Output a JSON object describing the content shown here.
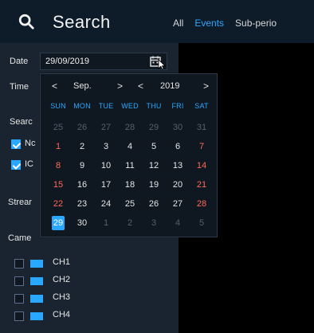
{
  "header": {
    "title": "Search",
    "tabs": [
      {
        "label": "All",
        "active": false
      },
      {
        "label": "Events",
        "active": true
      },
      {
        "label": "Sub-perio",
        "active": false
      }
    ]
  },
  "sidebar": {
    "date_label": "Date",
    "date_value": "29/09/2019",
    "time_label": "Time",
    "search_label": "Searc",
    "search_options": [
      {
        "label": "Nc",
        "checked": true
      },
      {
        "label": "IC",
        "checked": true
      }
    ],
    "stream_label": "Strear",
    "camera_label": "Came",
    "channels": [
      {
        "label": "CH1",
        "checked": false
      },
      {
        "label": "CH2",
        "checked": false
      },
      {
        "label": "CH3",
        "checked": false
      },
      {
        "label": "CH4",
        "checked": false
      }
    ]
  },
  "calendar": {
    "month": "Sep.",
    "year": "2019",
    "prev_symbol": "<",
    "next_symbol": ">",
    "weekdays": [
      "SUN",
      "MON",
      "TUE",
      "WED",
      "THU",
      "FRI",
      "SAT"
    ],
    "days": [
      {
        "d": "25",
        "other": true
      },
      {
        "d": "26",
        "other": true
      },
      {
        "d": "27",
        "other": true
      },
      {
        "d": "28",
        "other": true
      },
      {
        "d": "29",
        "other": true
      },
      {
        "d": "30",
        "other": true
      },
      {
        "d": "31",
        "other": true
      },
      {
        "d": "1",
        "weekend": true
      },
      {
        "d": "2"
      },
      {
        "d": "3"
      },
      {
        "d": "4"
      },
      {
        "d": "5"
      },
      {
        "d": "6"
      },
      {
        "d": "7",
        "weekend": true
      },
      {
        "d": "8",
        "weekend": true
      },
      {
        "d": "9"
      },
      {
        "d": "10"
      },
      {
        "d": "11"
      },
      {
        "d": "12"
      },
      {
        "d": "13"
      },
      {
        "d": "14",
        "weekend": true
      },
      {
        "d": "15",
        "weekend": true
      },
      {
        "d": "16"
      },
      {
        "d": "17"
      },
      {
        "d": "18"
      },
      {
        "d": "19"
      },
      {
        "d": "20"
      },
      {
        "d": "21",
        "weekend": true
      },
      {
        "d": "22",
        "weekend": true
      },
      {
        "d": "23"
      },
      {
        "d": "24"
      },
      {
        "d": "25"
      },
      {
        "d": "26"
      },
      {
        "d": "27"
      },
      {
        "d": "28",
        "weekend": true
      },
      {
        "d": "29",
        "selected": true
      },
      {
        "d": "30"
      },
      {
        "d": "1",
        "other": true
      },
      {
        "d": "2",
        "other": true
      },
      {
        "d": "3",
        "other": true
      },
      {
        "d": "4",
        "other": true
      },
      {
        "d": "5",
        "other": true
      }
    ]
  },
  "colors": {
    "accent": "#2aa8ff",
    "weekend": "#ff6b5a",
    "panel": "#1a2430",
    "header": "#0e1b28"
  },
  "icons": {
    "search": "search-icon",
    "calendar": "calendar-icon",
    "cursor": "mouse-cursor-icon"
  }
}
